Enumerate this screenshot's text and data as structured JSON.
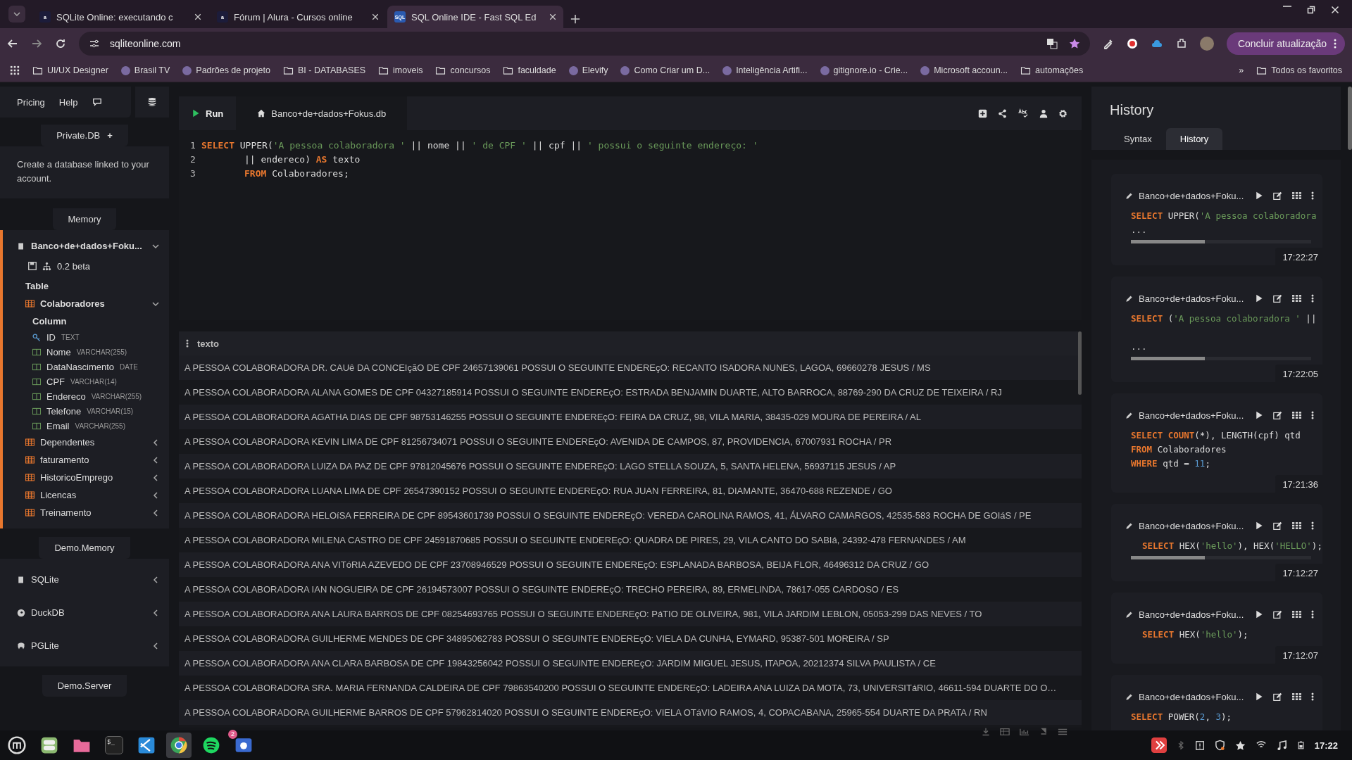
{
  "browser": {
    "tabs": [
      {
        "title": "SQLite Online: executando c",
        "kind": "alura",
        "favicon_text": "a",
        "selected": false
      },
      {
        "title": "Fórum | Alura - Cursos online",
        "kind": "alura",
        "favicon_text": "a",
        "selected": false
      },
      {
        "title": "SQL Online IDE - Fast SQL Ed",
        "kind": "sql",
        "favicon_text": "SQL",
        "selected": true
      }
    ],
    "url": "sqliteonline.com",
    "update_button": "Concluir atualização",
    "bookmarks": [
      {
        "label": "UI/UX Designer",
        "kind": "folder"
      },
      {
        "label": "Brasil TV",
        "kind": "site"
      },
      {
        "label": "Padrões de projeto",
        "kind": "site"
      },
      {
        "label": "BI - DATABASES",
        "kind": "folder"
      },
      {
        "label": "imoveis",
        "kind": "folder"
      },
      {
        "label": "concursos",
        "kind": "folder"
      },
      {
        "label": "faculdade",
        "kind": "folder"
      },
      {
        "label": "Elevify",
        "kind": "site"
      },
      {
        "label": "Como Criar um D...",
        "kind": "site"
      },
      {
        "label": "Inteligência Artifi...",
        "kind": "site"
      },
      {
        "label": "gitignore.io - Crie...",
        "kind": "site"
      },
      {
        "label": "Microsoft accoun...",
        "kind": "site"
      },
      {
        "label": "automações",
        "kind": "folder"
      }
    ],
    "more_bookmarks": "»",
    "all_bookmarks": "Todos os favoritos"
  },
  "sidebar": {
    "nav": [
      "Pricing",
      "Help"
    ],
    "private_db": {
      "title": "Private.DB",
      "add": "+",
      "text": "Create a database linked to your account."
    },
    "memory": {
      "title": "Memory",
      "db": "Banco+de+dados+Foku...",
      "expanded": true,
      "version": "0.2 beta",
      "table_heading": "Table",
      "tables": [
        {
          "name": "Colaboradores",
          "expanded": true,
          "column_heading": "Column",
          "columns": [
            {
              "name": "ID",
              "type": "TEXT",
              "kind": "key"
            },
            {
              "name": "Nome",
              "type": "VARCHAR(255)",
              "kind": "column"
            },
            {
              "name": "DataNascimento",
              "type": "DATE",
              "kind": "column"
            },
            {
              "name": "CPF",
              "type": "VARCHAR(14)",
              "kind": "column"
            },
            {
              "name": "Endereco",
              "type": "VARCHAR(255)",
              "kind": "column"
            },
            {
              "name": "Telefone",
              "type": "VARCHAR(15)",
              "kind": "column"
            },
            {
              "name": "Email",
              "type": "VARCHAR(255)",
              "kind": "column"
            }
          ]
        },
        {
          "name": "Dependentes",
          "expanded": false
        },
        {
          "name": "faturamento",
          "expanded": false
        },
        {
          "name": "HistoricoEmprego",
          "expanded": false
        },
        {
          "name": "Licencas",
          "expanded": false
        },
        {
          "name": "Treinamento",
          "expanded": false
        }
      ]
    },
    "demo_memory": {
      "title": "Demo.Memory",
      "items": [
        {
          "name": "SQLite",
          "kind": "sqlite",
          "expanded": false
        },
        {
          "name": "DuckDB",
          "kind": "duckdb",
          "expanded": false
        },
        {
          "name": "PGLite",
          "kind": "pglite",
          "expanded": false
        }
      ]
    },
    "demo_server": {
      "title": "Demo.Server"
    }
  },
  "editor": {
    "run": "Run",
    "file_tab": "Banco+de+dados+Fokus.db",
    "lines": [
      {
        "number": "1",
        "indent": false,
        "tokens": [
          {
            "kind": "keyword",
            "text": "SELECT"
          },
          {
            "kind": "plain",
            "text": " UPPER("
          },
          {
            "kind": "string",
            "text": "'A pessoa colaboradora '"
          },
          {
            "kind": "plain",
            "text": " || nome || "
          },
          {
            "kind": "string",
            "text": "' de CPF '"
          },
          {
            "kind": "plain",
            "text": " || cpf || "
          },
          {
            "kind": "string",
            "text": "' possui o seguinte endereço: '"
          }
        ]
      },
      {
        "number": "2",
        "indent": true,
        "tokens": [
          {
            "kind": "plain",
            "text": "|| endereco) "
          },
          {
            "kind": "keyword",
            "text": "AS"
          },
          {
            "kind": "plain",
            "text": " texto"
          }
        ]
      },
      {
        "number": "3",
        "indent": true,
        "tokens": [
          {
            "kind": "keyword",
            "text": "FROM"
          },
          {
            "kind": "plain",
            "text": " Colaboradores;"
          }
        ]
      }
    ]
  },
  "results": {
    "column": "texto",
    "rows": [
      "A PESSOA COLABORADORA DR. CAUê DA CONCEIçãO DE CPF 24657139061 POSSUI O SEGUINTE ENDEREçO: RECANTO ISADORA NUNES, LAGOA, 69660278 JESUS / MS",
      "A PESSOA COLABORADORA ALANA GOMES DE CPF 04327185914 POSSUI O SEGUINTE ENDEREçO: ESTRADA BENJAMIN DUARTE, ALTO BARROCA, 88769-290 DA CRUZ DE TEIXEIRA / RJ",
      "A PESSOA COLABORADORA AGATHA DIAS DE CPF 98753146255 POSSUI O SEGUINTE ENDEREçO: FEIRA DA CRUZ, 98, VILA MARIA, 38435-029 MOURA DE PEREIRA / AL",
      "A PESSOA COLABORADORA KEVIN LIMA DE CPF 81256734071 POSSUI O SEGUINTE ENDEREçO: AVENIDA DE CAMPOS, 87, PROVIDENCIA, 67007931 ROCHA / PR",
      "A PESSOA COLABORADORA LUIZA DA PAZ DE CPF 97812045676 POSSUI O SEGUINTE ENDEREçO: LAGO STELLA SOUZA, 5, SANTA HELENA, 56937115 JESUS / AP",
      "A PESSOA COLABORADORA LUANA LIMA DE CPF 26547390152 POSSUI O SEGUINTE ENDEREçO: RUA JUAN FERREIRA, 81, DIAMANTE, 36470-688 REZENDE / GO",
      "A PESSOA COLABORADORA HELOíSA FERREIRA DE CPF 89543601739 POSSUI O SEGUINTE ENDEREçO: VEREDA CAROLINA RAMOS, 41, ÁLVARO CAMARGOS, 42535-583 ROCHA DE GOIáS / PE",
      "A PESSOA COLABORADORA MILENA CASTRO DE CPF 24591870685 POSSUI O SEGUINTE ENDEREçO: QUADRA DE PIRES, 29, VILA CANTO DO SABIá, 24392-478 FERNANDES / AM",
      "A PESSOA COLABORADORA ANA VITóRIA AZEVEDO DE CPF 23708946529 POSSUI O SEGUINTE ENDEREçO: ESPLANADA BARBOSA, BEIJA FLOR, 46496312 DA CRUZ / GO",
      "A PESSOA COLABORADORA IAN NOGUEIRA DE CPF 26194573007 POSSUI O SEGUINTE ENDEREçO: TRECHO PEREIRA, 89, ERMELINDA, 78617-055 CARDOSO / ES",
      "A PESSOA COLABORADORA ANA LAURA BARROS DE CPF 08254693765 POSSUI O SEGUINTE ENDEREçO: PáTIO DE OLIVEIRA, 981, VILA JARDIM LEBLON, 05053-299 DAS NEVES / TO",
      "A PESSOA COLABORADORA GUILHERME MENDES DE CPF 34895062783 POSSUI O SEGUINTE ENDEREçO: VIELA DA CUNHA, EYMARD, 95387-501 MOREIRA / SP",
      "A PESSOA COLABORADORA ANA CLARA BARBOSA DE CPF 19843256042 POSSUI O SEGUINTE ENDEREçO: JARDIM MIGUEL JESUS, ITAPOA, 20212374 SILVA PAULISTA / CE",
      "A PESSOA COLABORADORA SRA. MARIA FERNANDA CALDEIRA DE CPF 79863540200 POSSUI O SEGUINTE ENDEREçO: LADEIRA ANA LUIZA DA MOTA, 73, UNIVERSITáRIO, 46611-594 DUARTE DO O…",
      "A PESSOA COLABORADORA GUILHERME BARROS DE CPF 57962814020 POSSUI O SEGUINTE ENDEREçO: VIELA OTáVIO RAMOS, 4, COPACABANA, 25965-554 DUARTE DA PRATA / RN"
    ]
  },
  "history": {
    "title": "History",
    "tabs": [
      {
        "label": "Syntax",
        "selected": false
      },
      {
        "label": "History",
        "selected": true
      }
    ],
    "entries": [
      {
        "db": "Banco+de+dados+Foku...",
        "indent": false,
        "gap": false,
        "scrollbar": true,
        "time": "17:22:27",
        "more": "...",
        "lines": [
          [
            {
              "kind": "keyword",
              "text": "SELECT"
            },
            {
              "kind": "plain",
              "text": " UPPER("
            },
            {
              "kind": "string",
              "text": "'A pessoa colaboradora"
            }
          ]
        ]
      },
      {
        "db": "Banco+de+dados+Foku...",
        "indent": false,
        "gap": true,
        "scrollbar": true,
        "time": "17:22:05",
        "more": "...",
        "lines": [
          [
            {
              "kind": "keyword",
              "text": "SELECT"
            },
            {
              "kind": "plain",
              "text": " ("
            },
            {
              "kind": "string",
              "text": "'A pessoa colaboradora '"
            },
            {
              "kind": "plain",
              "text": " ||"
            }
          ]
        ]
      },
      {
        "db": "Banco+de+dados+Foku...",
        "indent": false,
        "scrollbar": false,
        "time": "17:21:36",
        "lines": [
          [
            {
              "kind": "keyword",
              "text": "SELECT"
            },
            {
              "kind": "keyword",
              "text": " COUNT"
            },
            {
              "kind": "plain",
              "text": "(*), LENGTH(cpf) qtd"
            }
          ],
          [
            {
              "kind": "keyword",
              "text": "FROM"
            },
            {
              "kind": "plain",
              "text": " Colaboradores"
            }
          ],
          [
            {
              "kind": "keyword",
              "text": "WHERE"
            },
            {
              "kind": "plain",
              "text": " qtd = "
            },
            {
              "kind": "number",
              "text": "11"
            },
            {
              "kind": "plain",
              "text": ";"
            }
          ]
        ]
      },
      {
        "db": "Banco+de+dados+Foku...",
        "indent": true,
        "scrollbar": true,
        "time": "17:12:27",
        "lines": [
          [
            {
              "kind": "keyword",
              "text": "SELECT"
            },
            {
              "kind": "plain",
              "text": " HEX("
            },
            {
              "kind": "string",
              "text": "'hello'"
            },
            {
              "kind": "plain",
              "text": "), HEX("
            },
            {
              "kind": "string",
              "text": "'HELLO'"
            },
            {
              "kind": "plain",
              "text": ");"
            }
          ]
        ]
      },
      {
        "db": "Banco+de+dados+Foku...",
        "indent": true,
        "scrollbar": false,
        "time": "17:12:07",
        "lines": [
          [
            {
              "kind": "keyword",
              "text": "SELECT"
            },
            {
              "kind": "plain",
              "text": " HEX("
            },
            {
              "kind": "string",
              "text": "'hello'"
            },
            {
              "kind": "plain",
              "text": ");"
            }
          ]
        ]
      },
      {
        "db": "Banco+de+dados+Foku...",
        "indent": false,
        "scrollbar": false,
        "lines": [
          [
            {
              "kind": "keyword",
              "text": "SELECT"
            },
            {
              "kind": "plain",
              "text": " POWER("
            },
            {
              "kind": "number",
              "text": "2"
            },
            {
              "kind": "plain",
              "text": ", "
            },
            {
              "kind": "number",
              "text": "3"
            },
            {
              "kind": "plain",
              "text": ");"
            }
          ]
        ]
      }
    ]
  },
  "taskbar": {
    "apps": [
      {
        "kind": "menu",
        "selected": false
      },
      {
        "kind": "toggle",
        "selected": false
      },
      {
        "kind": "files",
        "selected": false
      },
      {
        "kind": "terminal",
        "selected": false
      },
      {
        "kind": "vscode",
        "selected": false
      },
      {
        "kind": "chrome",
        "selected": true
      },
      {
        "kind": "spotify",
        "selected": false
      },
      {
        "kind": "camera",
        "selected": false,
        "badge": "2"
      }
    ],
    "terminal_glyph": "$_",
    "time": "17:22"
  }
}
